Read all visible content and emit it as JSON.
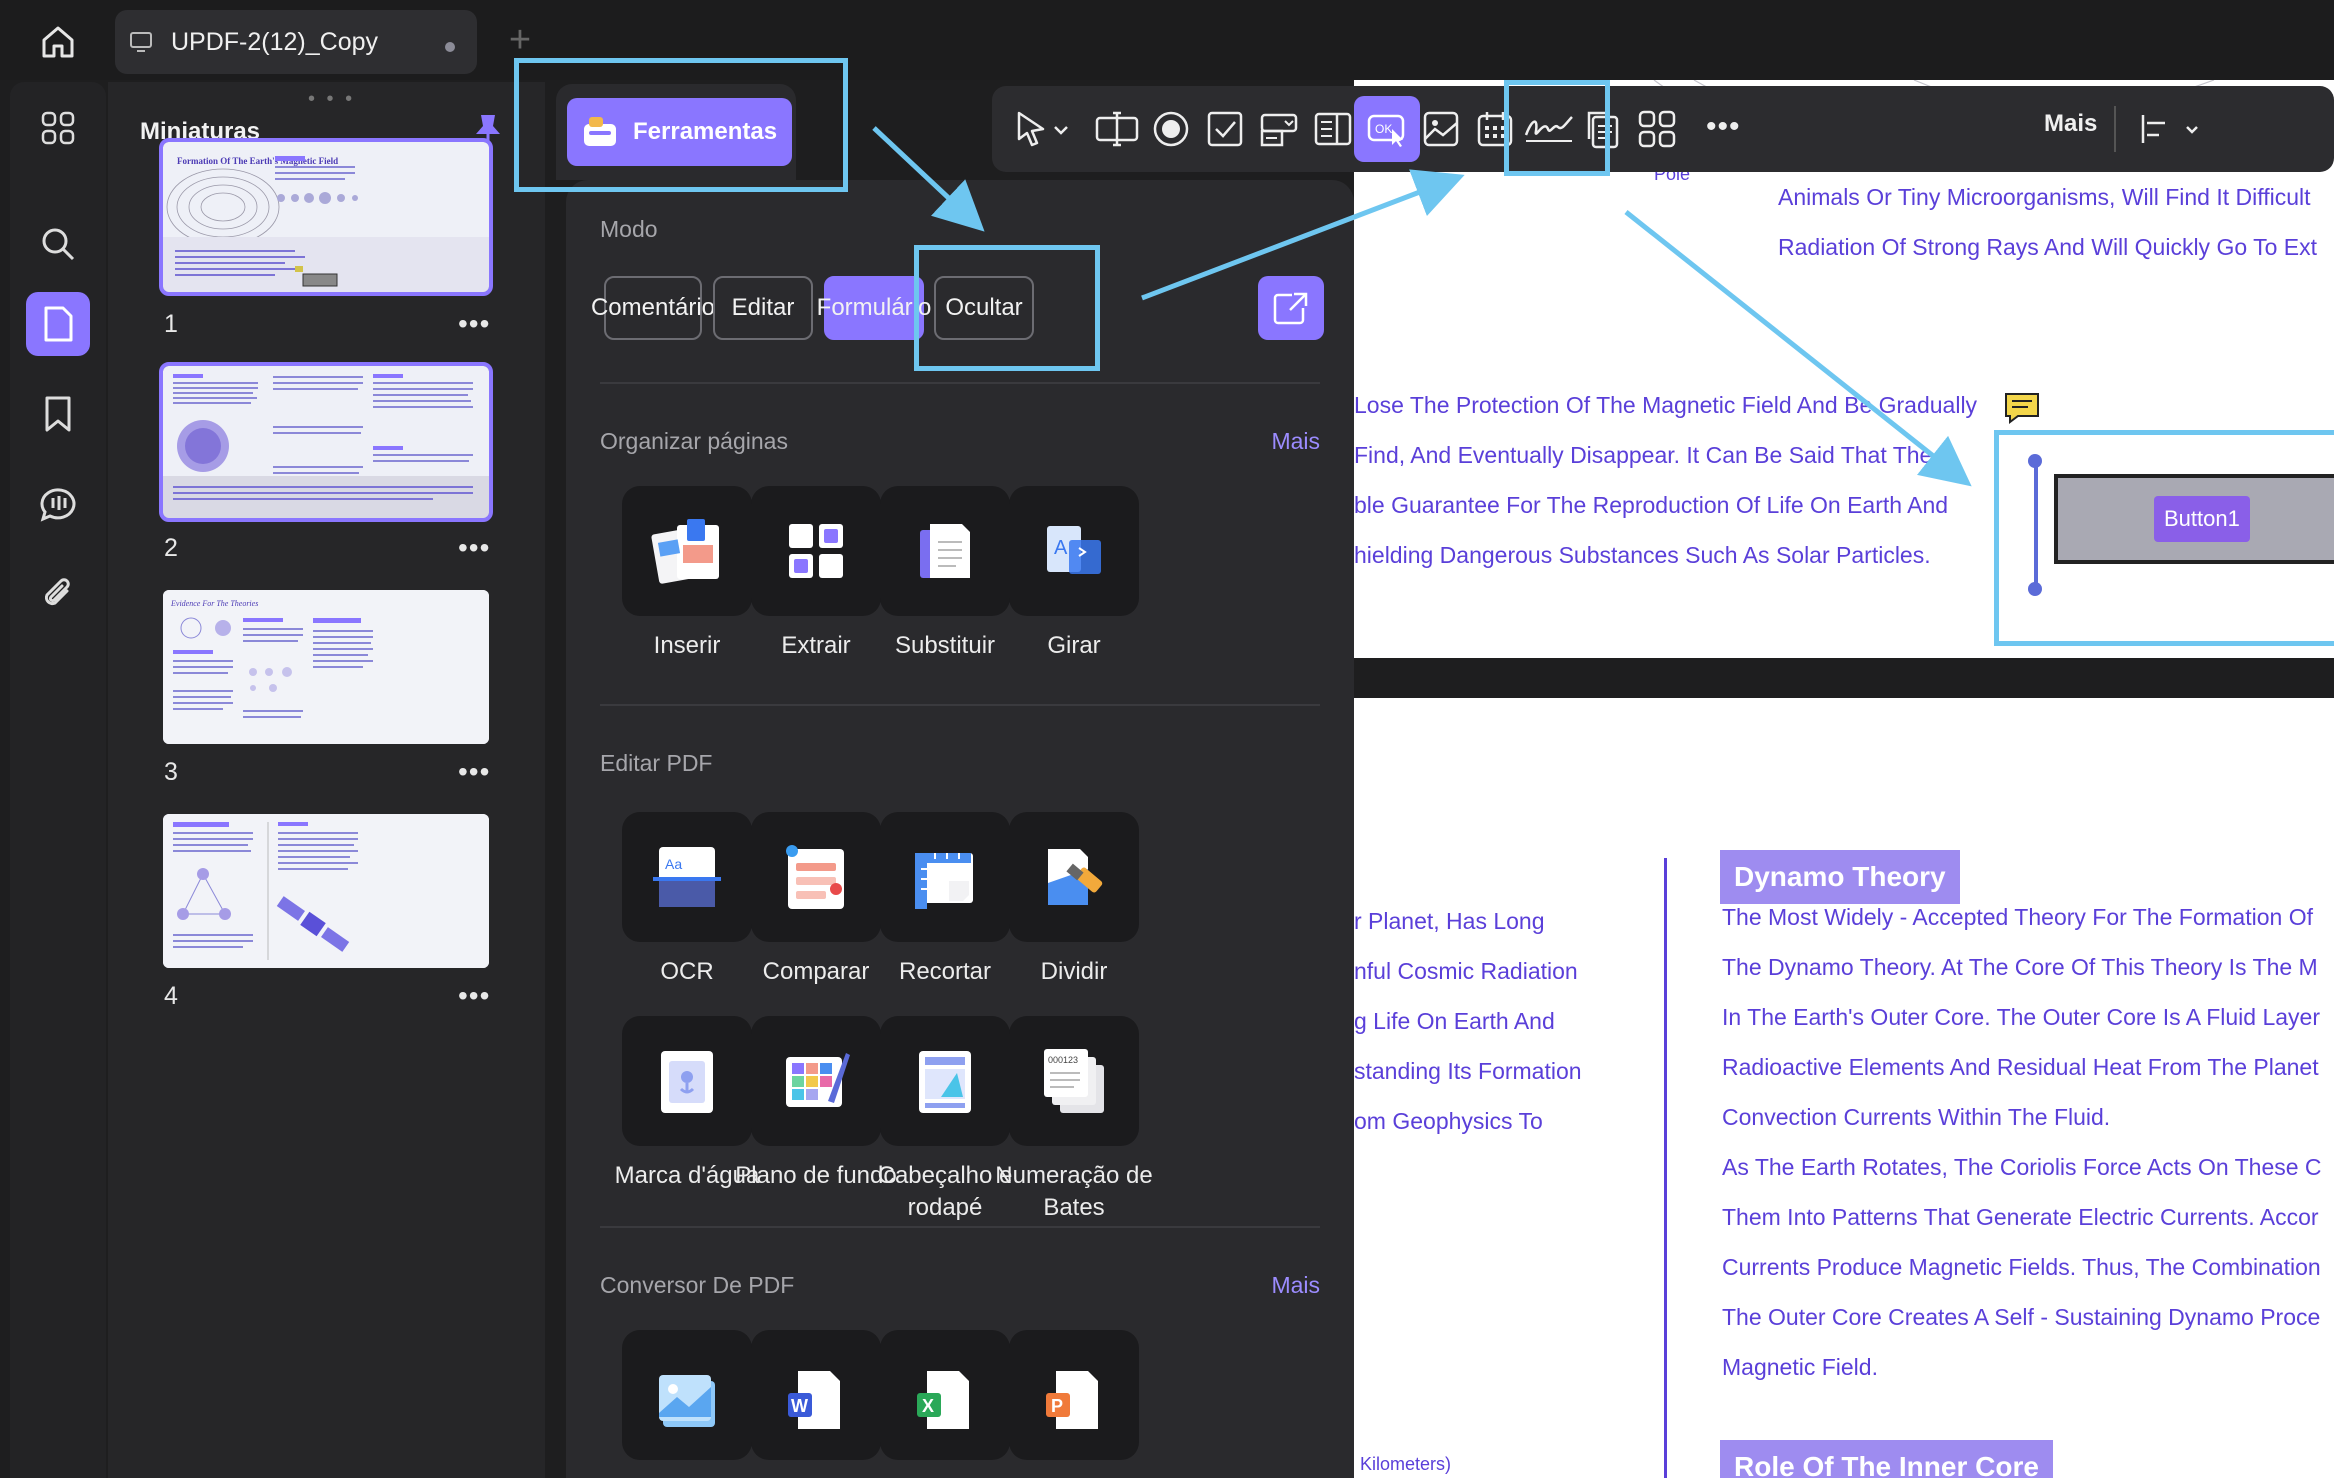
{
  "tab": {
    "title": "UPDF-2(12)_Copy"
  },
  "thumbnails": {
    "title": "Miniaturas",
    "pages": [
      {
        "num": "1",
        "heading": "Formation Of The Earth's Magnetic Field"
      },
      {
        "num": "2",
        "heading": ""
      },
      {
        "num": "3",
        "heading": "Evidence For The Theories"
      },
      {
        "num": "4",
        "heading": ""
      }
    ],
    "more": "•••"
  },
  "tools_button": {
    "label": "Ferramentas"
  },
  "tools": {
    "mode": {
      "title": "Modo",
      "buttons": [
        "Comentário",
        "Editar",
        "Formulário",
        "Ocultar"
      ],
      "active": "Formulário"
    },
    "organize": {
      "title": "Organizar páginas",
      "more": "Mais",
      "items": [
        "Inserir",
        "Extrair",
        "Substituir",
        "Girar"
      ]
    },
    "edit_pdf": {
      "title": "Editar PDF",
      "items": [
        "OCR",
        "Comparar",
        "Recortar",
        "Dividir",
        "Marca d'água",
        "Plano de fundo",
        "Cabeçalho e rodapé",
        "Numeração de Bates"
      ]
    },
    "converter": {
      "title": "Conversor De PDF",
      "more": "Mais"
    }
  },
  "toolbar": {
    "more_label": "Mais"
  },
  "document": {
    "page1_lines": [
      "Animals Or Tiny Microorganisms, Will Find It Difficult",
      "Radiation Of Strong Rays And Will Quickly Go To Ext",
      "Lose The Protection Of The Magnetic Field And Be Gradually",
      "Find, And Eventually Disappear. It Can Be Said That The",
      "ble Guarantee For The Reproduction Of Life On Earth And",
      "hielding Dangerous Substances Such As Solar Particles."
    ],
    "pole_label": "Pole",
    "form_button_label": "Button1",
    "dynamo_title": "Dynamo Theory",
    "left_col_lines": [
      "r Planet, Has Long",
      "nful Cosmic Radiation",
      "g Life On Earth And",
      "standing Its Formation",
      "om Geophysics To"
    ],
    "right_col_lines": [
      "The Most Widely - Accepted Theory For The Formation Of",
      "The Dynamo Theory. At The Core Of This Theory Is The M",
      "In The Earth's Outer Core. The Outer Core Is A Fluid Layer",
      "Radioactive Elements And Residual Heat From The Planet",
      "Convection Currents Within The Fluid.",
      "As The Earth Rotates, The Coriolis Force Acts On These C",
      "Them Into Patterns That Generate Electric Currents. Accor",
      "Currents Produce Magnetic Fields. Thus, The Combination",
      "The Outer Core Creates A Self - Sustaining Dynamo Proce",
      "Magnetic Field."
    ],
    "footnote": "Kilometers)",
    "inner_core_title": "Role Of The Inner Core"
  },
  "colors": {
    "accent": "#8a76ff",
    "highlight": "#6ec6f0",
    "doc_text": "#5a3fd9"
  }
}
